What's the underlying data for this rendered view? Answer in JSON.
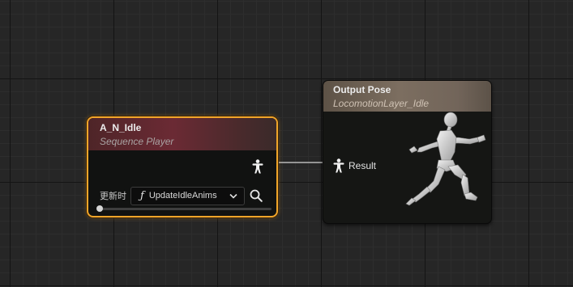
{
  "graph": {
    "sequence_player_node": {
      "title": "A_N_Idle",
      "subtitle": "Sequence Player",
      "update_label": "更新时",
      "function_label": "UpdateIdleAnims",
      "function_icon": "ƒ",
      "output_pin_icon": "pose-pin-icon",
      "search_icon": "search-icon",
      "dropdown_icon": "chevron-down-icon",
      "selected": true,
      "accent_color": "#f0a52a",
      "play_position": 0
    },
    "output_pose_node": {
      "title": "Output Pose",
      "subtitle": "LocomotionLayer_Idle",
      "input_pin_label": "Result",
      "input_pin_icon": "pose-pin-icon",
      "preview_icon": "mannequin-running-icon"
    },
    "wire_color": "#b9b9b9"
  }
}
